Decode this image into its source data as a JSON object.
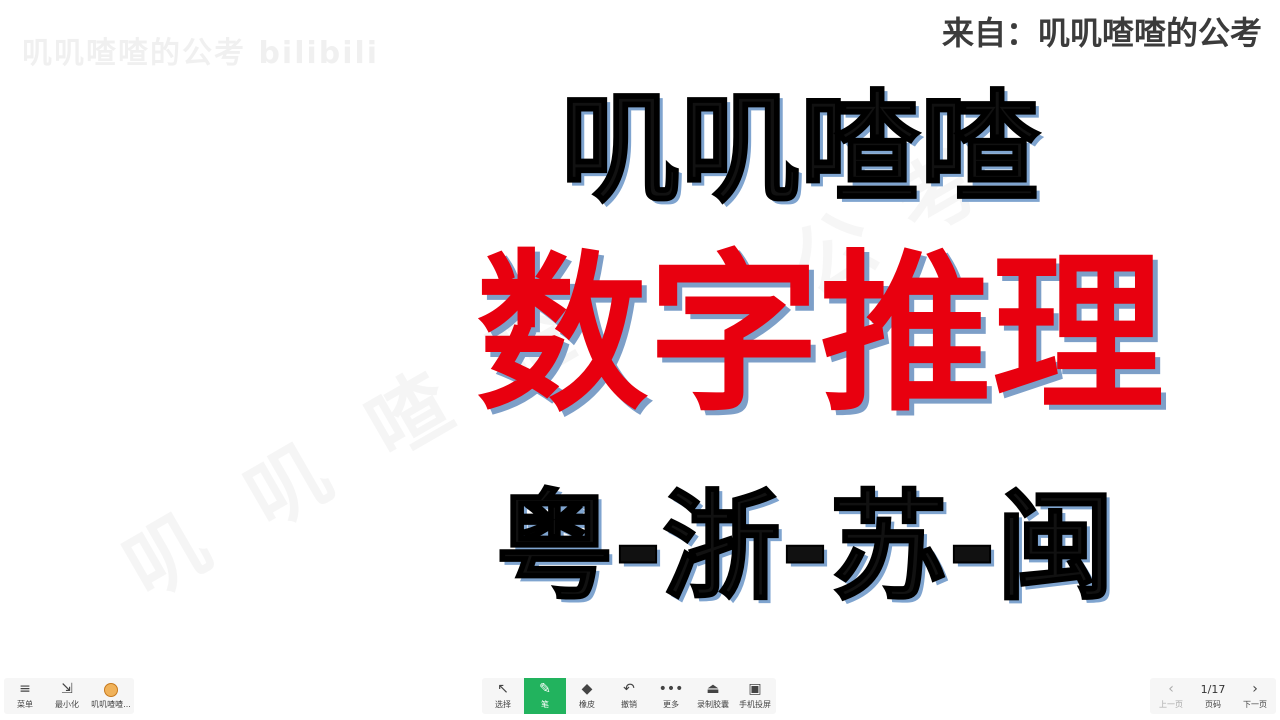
{
  "watermarks": {
    "top": "叽叽喳喳的公考 bilibili",
    "diagonal": "叽叽喳喳",
    "diagonal2": "公考"
  },
  "source": "来自：叽叽喳喳的公考",
  "slide": {
    "line1": "叽叽喳喳",
    "line2": "数字推理",
    "line3": "粤-浙-苏-闽"
  },
  "toolbar": {
    "left": [
      {
        "icon": "≡",
        "label": "菜单"
      },
      {
        "icon": "⇲",
        "label": "最小化"
      },
      {
        "icon": "",
        "label": "叽叽喳喳..."
      }
    ],
    "center": [
      {
        "icon": "↖",
        "label": "选择"
      },
      {
        "icon": "✎",
        "label": "笔"
      },
      {
        "icon": "◆",
        "label": "橡皮"
      },
      {
        "icon": "↶",
        "label": "撤销"
      },
      {
        "icon": "•••",
        "label": "更多"
      },
      {
        "icon": "⏏",
        "label": "录制胶囊"
      },
      {
        "icon": "▣",
        "label": "手机投屏"
      }
    ],
    "right": [
      {
        "icon": "‹",
        "label": "上一页"
      },
      {
        "icon": "1/17",
        "label": "页码"
      },
      {
        "icon": "›",
        "label": "下一页"
      }
    ]
  },
  "colors": {
    "title_red": "#e8000f",
    "shadow_blue": "#7fa4cf",
    "active_green": "#22b35e"
  }
}
